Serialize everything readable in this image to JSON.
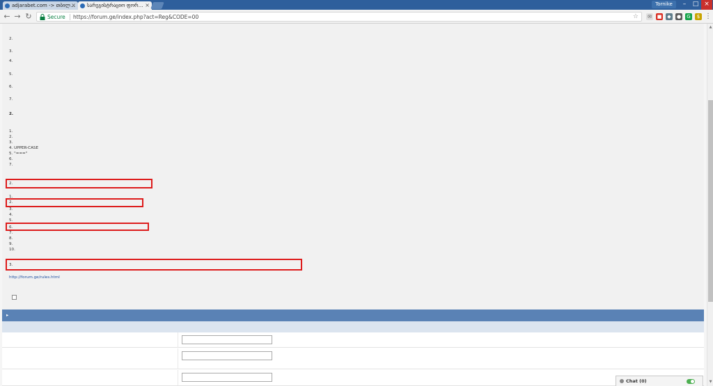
{
  "browser": {
    "tabs": [
      {
        "title": "adjarabet.com -> თბილ…",
        "active": false
      },
      {
        "title": "სარეგისტრაციო ფორ…",
        "active": true
      }
    ],
    "profile": "Tornike",
    "secure_label": "Secure",
    "url": "https://forum.ge/index.php?act=Reg&CODE=00",
    "extensions": [
      {
        "icon": "mail-icon",
        "color": "#e0e0e0"
      },
      {
        "icon": "adblock-icon",
        "color": "#d93025"
      },
      {
        "icon": "extension-icon",
        "color": "#607d8b"
      },
      {
        "icon": "shield-icon",
        "color": "#5a5a5a"
      },
      {
        "icon": "grammarly-icon",
        "color": "#15a34a"
      },
      {
        "icon": "coin-icon",
        "color": "#c8a400"
      }
    ]
  },
  "rules": {
    "lines": [
      {
        "text": "",
        "bold": false
      },
      {
        "text": "2.",
        "bold": false
      },
      {
        "text": "",
        "bold": false
      },
      {
        "text": "3.",
        "bold": false
      },
      {
        "text": "4.",
        "bold": false
      },
      {
        "text": "5.",
        "bold": false
      },
      {
        "text": "6.",
        "bold": false
      },
      {
        "text": "7.",
        "bold": false
      },
      {
        "text": "2.",
        "bold": true
      },
      {
        "text": "",
        "bold": false
      },
      {
        "text": "1.",
        "bold": false
      },
      {
        "text": "2.",
        "bold": false
      },
      {
        "text": "3.",
        "bold": false
      },
      {
        "text": "4. UPPER-CASE",
        "bold": false
      },
      {
        "text": "5. \"===\"",
        "bold": false
      },
      {
        "text": "6.",
        "bold": false
      },
      {
        "text": "7.",
        "bold": false
      },
      {
        "text": "2.",
        "bold": false
      },
      {
        "text": "1.",
        "bold": false
      },
      {
        "text": "2.",
        "bold": false
      },
      {
        "text": "3.",
        "bold": false
      },
      {
        "text": "4.",
        "bold": false
      },
      {
        "text": "5.",
        "bold": false
      },
      {
        "text": "6.",
        "bold": false
      },
      {
        "text": "7.",
        "bold": false
      },
      {
        "text": "8.",
        "bold": false
      },
      {
        "text": "9.",
        "bold": false
      },
      {
        "text": "10.",
        "bold": false
      },
      {
        "text": "3.",
        "bold": false
      },
      {
        "text": "http://forum.ge/rules.html",
        "bold": false
      }
    ],
    "agree_label": "",
    "agree_link": ""
  },
  "form": {
    "header": "",
    "subheader": "",
    "fields": [
      {
        "label": "",
        "description": "",
        "value": ""
      },
      {
        "label": "",
        "description": "",
        "value": ""
      },
      {
        "label": "",
        "description": "",
        "value": ""
      }
    ]
  },
  "chat": {
    "label": "Chat (0)"
  }
}
